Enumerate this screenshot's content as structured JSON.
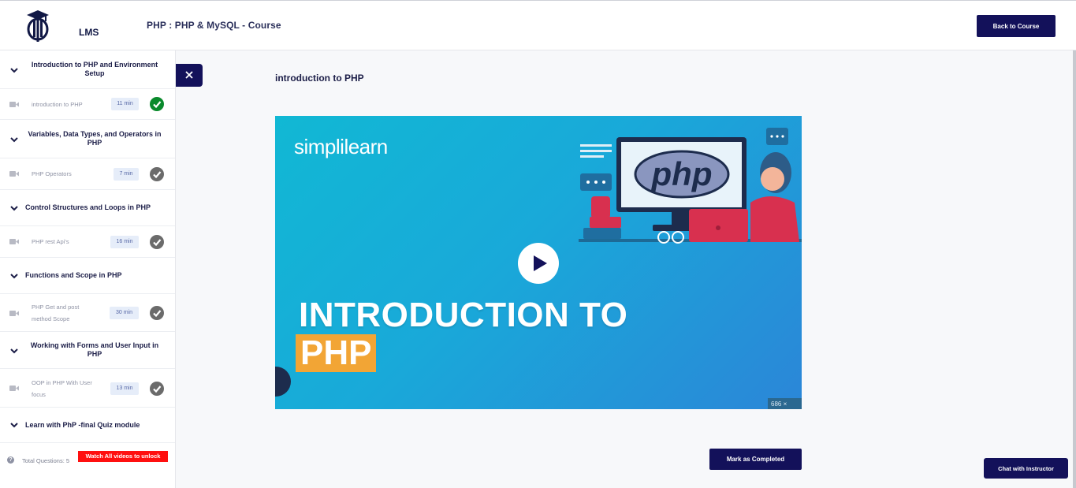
{
  "header": {
    "logo_text": "LMS",
    "course_title": "PHP : PHP & MySQL - Course",
    "back_button": "Back to Course"
  },
  "sidebar": {
    "sections": [
      {
        "title": "Introduction to PHP and Environment Setup",
        "lesson": "introduction to PHP",
        "duration": "11 min",
        "status": "completed"
      },
      {
        "title": "Variables, Data Types, and Operators in PHP",
        "lesson": "PHP Operators",
        "duration": "7 min",
        "status": "pending"
      },
      {
        "title": "Control Structures and Loops in PHP",
        "lesson": "PHP rest Api's",
        "duration": "16 min",
        "status": "pending"
      },
      {
        "title": "Functions and Scope in PHP",
        "lesson": "PHP Get and post method Scope",
        "duration": "30 min",
        "status": "pending"
      },
      {
        "title": "Working with Forms and User Input in PHP",
        "lesson": "OOP in PHP With User focus",
        "duration": "13 min",
        "status": "pending"
      },
      {
        "title": "Learn with PhP -final Quiz module"
      }
    ],
    "quiz": {
      "total_questions": "Total Questions: 5",
      "unlock_notice": "Watch All videos to unlock"
    }
  },
  "main": {
    "lesson_title": "introduction to PHP",
    "video": {
      "brand": "simplilearn",
      "title_line1": "INTRODUCTION TO",
      "title_line2": "PHP",
      "illustration_logo": "php",
      "corner_tag": "686 ×"
    },
    "mark_completed": "Mark as Completed"
  },
  "chat_button": "Chat with Instructor",
  "colors": {
    "primary": "#13115a",
    "completed": "#0a8a2c",
    "pending": "#6b6b6b",
    "unlock": "#ff1010"
  }
}
